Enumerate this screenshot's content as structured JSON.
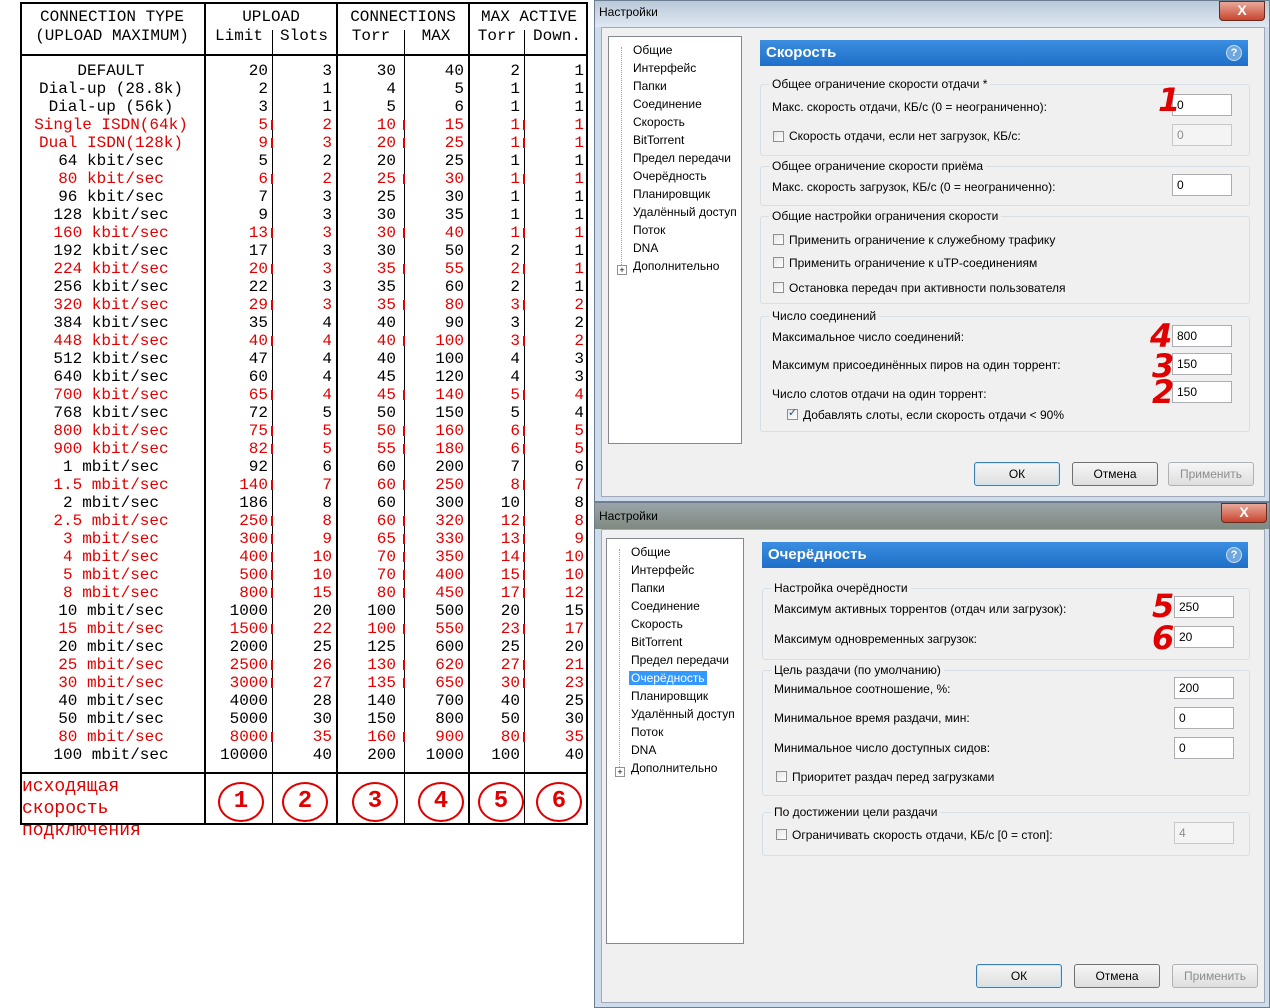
{
  "table": {
    "header": {
      "type_line1": "CONNECTION TYPE",
      "type_line2": "(UPLOAD MAXIMUM)",
      "upload": "UPLOAD",
      "limit": "Limit",
      "slots": "Slots",
      "connections": "CONNECTIONS",
      "torr": "Torr",
      "max": "MAX",
      "max_active": "MAX ACTIVE",
      "torr2": "Torr",
      "down": "Down."
    },
    "rows": [
      {
        "name": "DEFAULT",
        "v": [
          "20",
          "3",
          "30",
          "40",
          "2",
          "1"
        ],
        "red": false
      },
      {
        "name": "Dial-up (28.8k)",
        "v": [
          "2",
          "1",
          "4",
          "5",
          "1",
          "1"
        ],
        "red": false
      },
      {
        "name": "Dial-up (56k)",
        "v": [
          "3",
          "1",
          "5",
          "6",
          "1",
          "1"
        ],
        "red": false
      },
      {
        "name": "Single ISDN(64k)",
        "v": [
          "5",
          "2",
          "10",
          "15",
          "1",
          "1"
        ],
        "red": true
      },
      {
        "name": "Dual ISDN(128k)",
        "v": [
          "9",
          "3",
          "20",
          "25",
          "1",
          "1"
        ],
        "red": true
      },
      {
        "name": "64 kbit/sec",
        "v": [
          "5",
          "2",
          "20",
          "25",
          "1",
          "1"
        ],
        "red": false
      },
      {
        "name": "80 kbit/sec",
        "v": [
          "6",
          "2",
          "25",
          "30",
          "1",
          "1"
        ],
        "red": true
      },
      {
        "name": "96 kbit/sec",
        "v": [
          "7",
          "3",
          "25",
          "30",
          "1",
          "1"
        ],
        "red": false
      },
      {
        "name": "128 kbit/sec",
        "v": [
          "9",
          "3",
          "30",
          "35",
          "1",
          "1"
        ],
        "red": false
      },
      {
        "name": "160 kbit/sec",
        "v": [
          "13",
          "3",
          "30",
          "40",
          "1",
          "1"
        ],
        "red": true
      },
      {
        "name": "192 kbit/sec",
        "v": [
          "17",
          "3",
          "30",
          "50",
          "2",
          "1"
        ],
        "red": false
      },
      {
        "name": "224 kbit/sec",
        "v": [
          "20",
          "3",
          "35",
          "55",
          "2",
          "1"
        ],
        "red": true
      },
      {
        "name": "256 kbit/sec",
        "v": [
          "22",
          "3",
          "35",
          "60",
          "2",
          "1"
        ],
        "red": false
      },
      {
        "name": "320 kbit/sec",
        "v": [
          "29",
          "3",
          "35",
          "80",
          "3",
          "2"
        ],
        "red": true
      },
      {
        "name": "384 kbit/sec",
        "v": [
          "35",
          "4",
          "40",
          "90",
          "3",
          "2"
        ],
        "red": false
      },
      {
        "name": "448 kbit/sec",
        "v": [
          "40",
          "4",
          "40",
          "100",
          "3",
          "2"
        ],
        "red": true
      },
      {
        "name": "512 kbit/sec",
        "v": [
          "47",
          "4",
          "40",
          "100",
          "4",
          "3"
        ],
        "red": false
      },
      {
        "name": "640 kbit/sec",
        "v": [
          "60",
          "4",
          "45",
          "120",
          "4",
          "3"
        ],
        "red": false
      },
      {
        "name": "700 kbit/sec",
        "v": [
          "65",
          "4",
          "45",
          "140",
          "5",
          "4"
        ],
        "red": true
      },
      {
        "name": "768 kbit/sec",
        "v": [
          "72",
          "5",
          "50",
          "150",
          "5",
          "4"
        ],
        "red": false
      },
      {
        "name": "800 kbit/sec",
        "v": [
          "75",
          "5",
          "50",
          "160",
          "6",
          "5"
        ],
        "red": true
      },
      {
        "name": "900 kbit/sec",
        "v": [
          "82",
          "5",
          "55",
          "180",
          "6",
          "5"
        ],
        "red": true
      },
      {
        "name": "1 mbit/sec",
        "v": [
          "92",
          "6",
          "60",
          "200",
          "7",
          "6"
        ],
        "red": false
      },
      {
        "name": "1.5 mbit/sec",
        "v": [
          "140",
          "7",
          "60",
          "250",
          "8",
          "7"
        ],
        "red": true
      },
      {
        "name": "2 mbit/sec",
        "v": [
          "186",
          "8",
          "60",
          "300",
          "10",
          "8"
        ],
        "red": false
      },
      {
        "name": "2.5 mbit/sec",
        "v": [
          "250",
          "8",
          "60",
          "320",
          "12",
          "8"
        ],
        "red": true
      },
      {
        "name": "3 mbit/sec",
        "v": [
          "300",
          "9",
          "65",
          "330",
          "13",
          "9"
        ],
        "red": true
      },
      {
        "name": "4 mbit/sec",
        "v": [
          "400",
          "10",
          "70",
          "350",
          "14",
          "10"
        ],
        "red": true
      },
      {
        "name": "5 mbit/sec",
        "v": [
          "500",
          "10",
          "70",
          "400",
          "15",
          "10"
        ],
        "red": true
      },
      {
        "name": "8 mbit/sec",
        "v": [
          "800",
          "15",
          "80",
          "450",
          "17",
          "12"
        ],
        "red": true
      },
      {
        "name": "10 mbit/sec",
        "v": [
          "1000",
          "20",
          "100",
          "500",
          "20",
          "15"
        ],
        "red": false
      },
      {
        "name": "15 mbit/sec",
        "v": [
          "1500",
          "22",
          "100",
          "550",
          "23",
          "17"
        ],
        "red": true
      },
      {
        "name": "20 mbit/sec",
        "v": [
          "2000",
          "25",
          "125",
          "600",
          "25",
          "20"
        ],
        "red": false
      },
      {
        "name": "25 mbit/sec",
        "v": [
          "2500",
          "26",
          "130",
          "620",
          "27",
          "21"
        ],
        "red": true
      },
      {
        "name": "30 mbit/sec",
        "v": [
          "3000",
          "27",
          "135",
          "650",
          "30",
          "23"
        ],
        "red": true
      },
      {
        "name": "40 mbit/sec",
        "v": [
          "4000",
          "28",
          "140",
          "700",
          "40",
          "25"
        ],
        "red": false
      },
      {
        "name": "50 mbit/sec",
        "v": [
          "5000",
          "30",
          "150",
          "800",
          "50",
          "30"
        ],
        "red": false
      },
      {
        "name": "80 mbit/sec",
        "v": [
          "8000",
          "35",
          "160",
          "900",
          "80",
          "35"
        ],
        "red": true
      },
      {
        "name": "100 mbit/sec",
        "v": [
          "10000",
          "40",
          "200",
          "1000",
          "100",
          "40"
        ],
        "red": false
      }
    ],
    "legend_text": "исходящая скорость подключения",
    "legend_nums": [
      "1",
      "2",
      "3",
      "4",
      "5",
      "6"
    ]
  },
  "colors": {
    "accent_red": "#e00000",
    "header_blue": "#1e6fc8",
    "select_blue": "#3399ff"
  },
  "dialog1": {
    "title": "Настройки",
    "close": "X",
    "tree": [
      "Общие",
      "Интерфейс",
      "Папки",
      "Соединение",
      "Скорость",
      "BitTorrent",
      "Предел передачи",
      "Очерёдность",
      "Планировщик",
      "Удалённый доступ",
      "Поток",
      "DNA",
      "Дополнительно"
    ],
    "tree_selected": "Скорость",
    "header": "Скорость",
    "help": "?",
    "g1": {
      "label": "Общее ограничение скорости отдачи *",
      "max_up": "Макс. скорость отдачи, КБ/с (0 = неограниченно):",
      "max_up_val": "0",
      "noload": "Скорость отдачи, если нет загрузок, КБ/с:",
      "noload_val": "0"
    },
    "g2": {
      "label": "Общее ограничение скорости приёма",
      "max_down": "Макс. скорость загрузок, КБ/с (0 = неограниченно):",
      "max_down_val": "0"
    },
    "g3": {
      "label": "Общие настройки ограничения скорости",
      "c1": "Применить ограничение к служебному трафику",
      "c2": "Применить ограничение к uTP-соединениям",
      "c3": "Остановка передач при активности пользователя"
    },
    "g4": {
      "label": "Число соединений",
      "max_conn": "Максимальное число соединений:",
      "max_conn_val": "800",
      "max_peers": "Максимум присоединённых пиров на один торрент:",
      "max_peers_val": "150",
      "slots": "Число слотов отдачи на один торрент:",
      "slots_val": "150",
      "add_slots": "Добавлять слоты, если скорость отдачи < 90%"
    },
    "marks": [
      "1",
      "4",
      "3",
      "2"
    ],
    "ok": "ОК",
    "cancel": "Отмена",
    "apply": "Применить"
  },
  "dialog2": {
    "title": "Настройки",
    "close": "X",
    "tree": [
      "Общие",
      "Интерфейс",
      "Папки",
      "Соединение",
      "Скорость",
      "BitTorrent",
      "Предел передачи",
      "Очерёдность",
      "Планировщик",
      "Удалённый доступ",
      "Поток",
      "DNA",
      "Дополнительно"
    ],
    "tree_selected": "Очерёдность",
    "header": "Очерёдность",
    "help": "?",
    "g1": {
      "label": "Настройка очерёдности",
      "max_active": "Максимум активных торрентов (отдач или загрузок):",
      "max_active_val": "250",
      "max_dl": "Максимум одновременных загрузок:",
      "max_dl_val": "20"
    },
    "g2": {
      "label": "Цель раздачи (по умолчанию)",
      "ratio": "Минимальное соотношение, %:",
      "ratio_val": "200",
      "time": "Минимальное время раздачи, мин:",
      "time_val": "0",
      "seeds": "Минимальное число доступных сидов:",
      "seeds_val": "0",
      "prio": "Приоритет раздач перед загрузками"
    },
    "g3": {
      "label": "По достижении цели раздачи",
      "limit": "Ограничивать скорость отдачи, КБ/с [0 = стоп]:",
      "limit_val": "4"
    },
    "marks": [
      "5",
      "6"
    ],
    "ok": "ОК",
    "cancel": "Отмена",
    "apply": "Применить"
  }
}
